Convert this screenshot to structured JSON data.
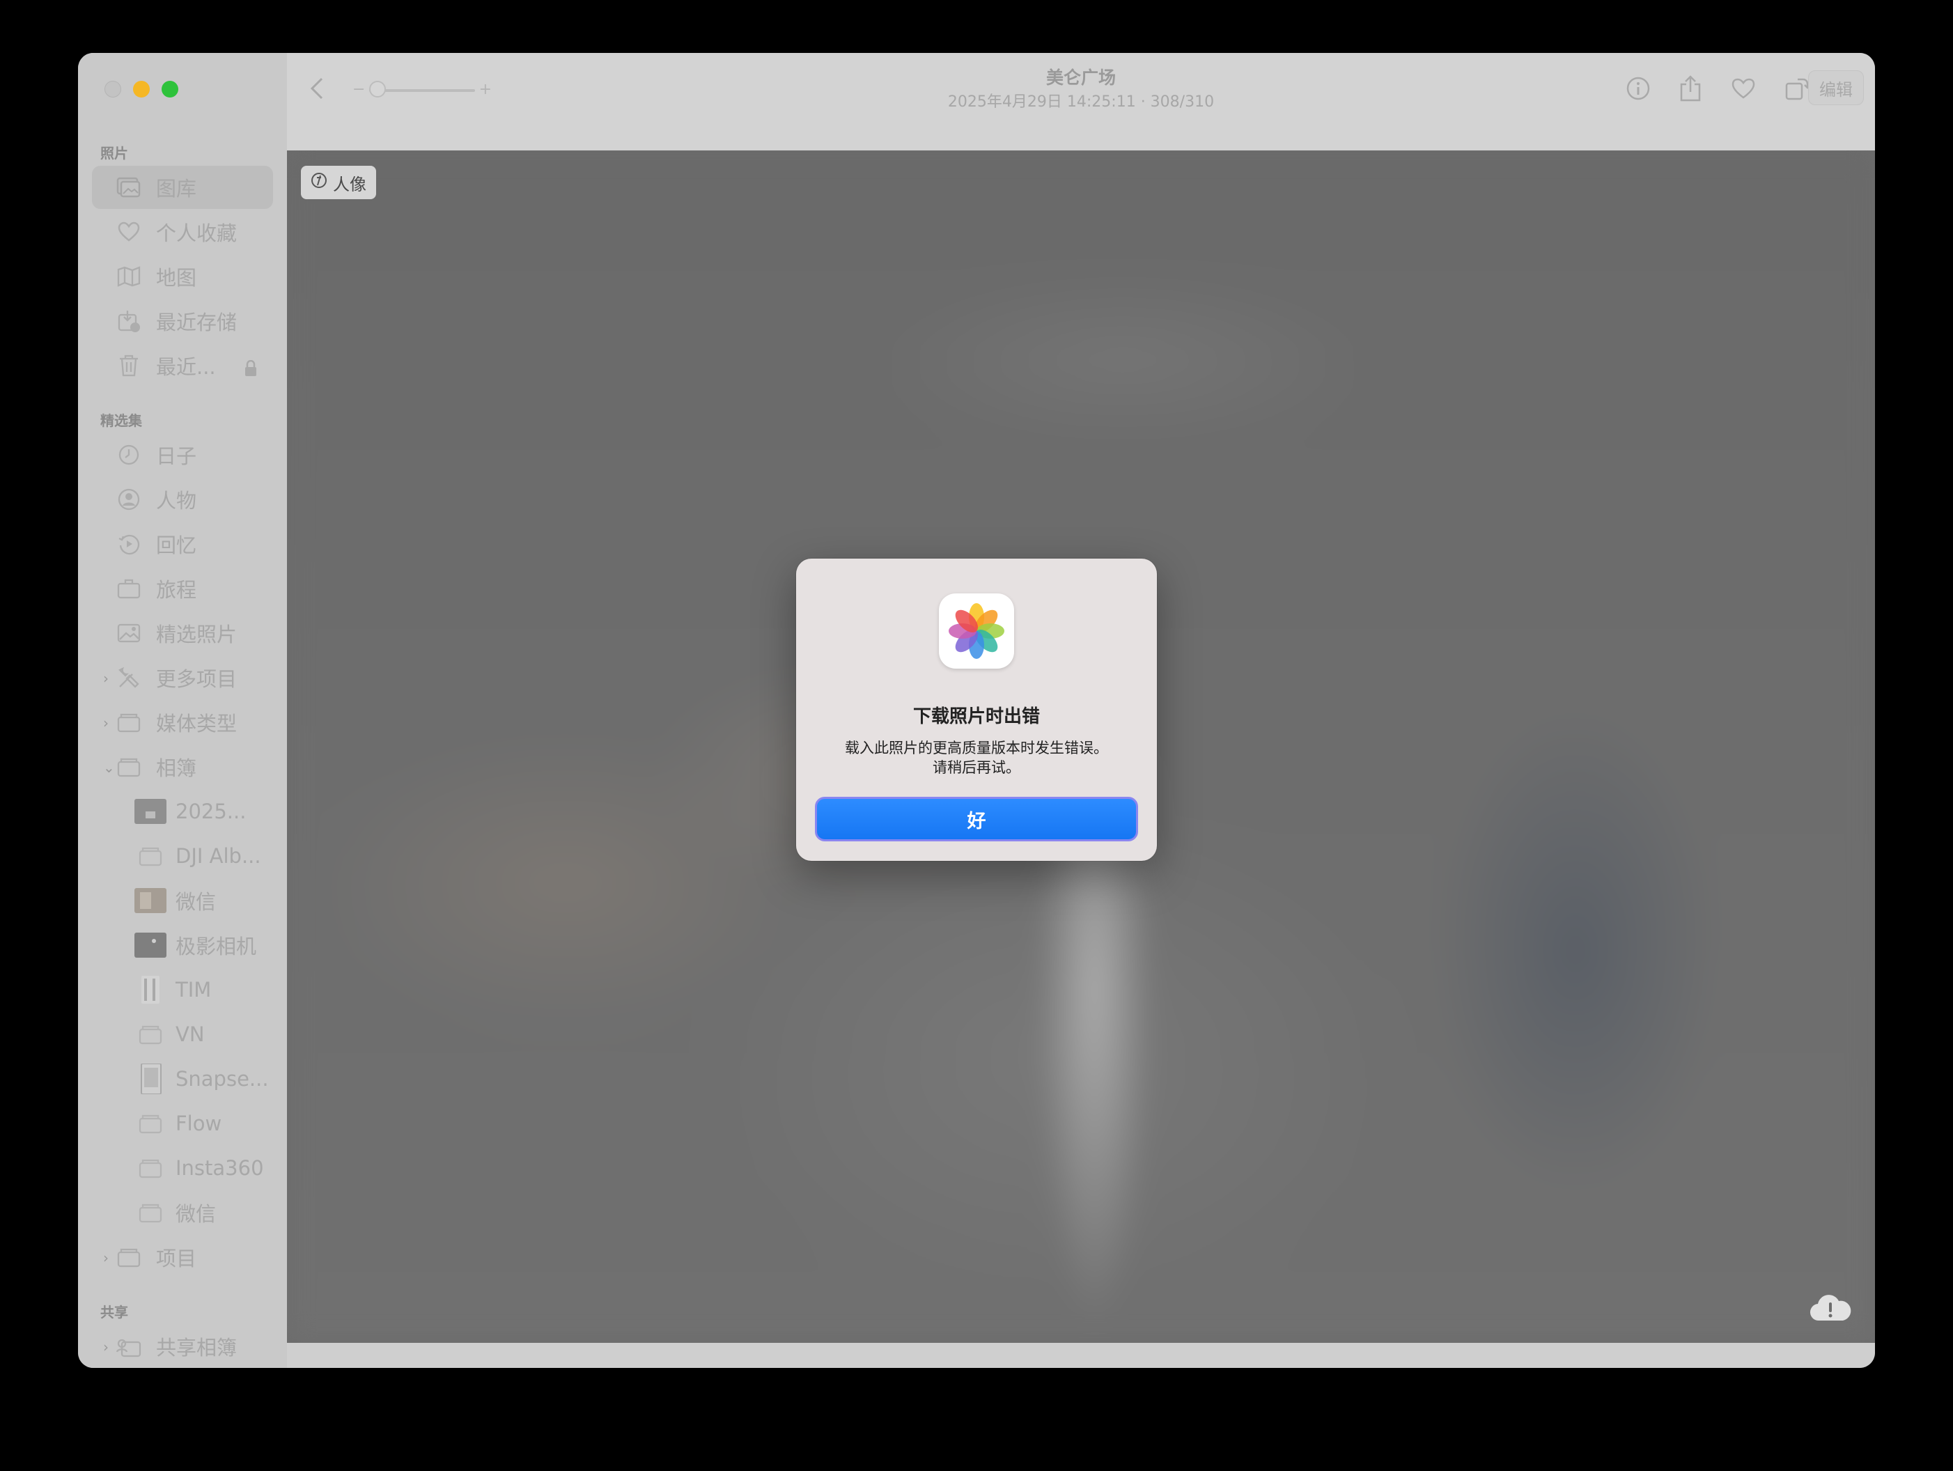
{
  "toolbar": {
    "title": "美仑广场",
    "subtitle": "2025年4月29日 14:25:11 · 308/310",
    "edit_label": "编辑",
    "zoom_minus": "−",
    "zoom_plus": "+"
  },
  "sidebar": {
    "section_photos": "照片",
    "section_featured": "精选集",
    "section_shared": "共享",
    "items": [
      {
        "label": "图库",
        "icon": "library-icon"
      },
      {
        "label": "个人收藏",
        "icon": "heart-icon"
      },
      {
        "label": "地图",
        "icon": "map-icon"
      },
      {
        "label": "最近存储",
        "icon": "recently-saved-icon"
      },
      {
        "label": "最近...",
        "icon": "trash-icon"
      },
      {
        "label": "日子",
        "icon": "clock-icon"
      },
      {
        "label": "人物",
        "icon": "person-icon"
      },
      {
        "label": "回忆",
        "icon": "memories-icon"
      },
      {
        "label": "旅程",
        "icon": "suitcase-icon"
      },
      {
        "label": "精选照片",
        "icon": "photo-icon"
      },
      {
        "label": "更多项目",
        "icon": "tools-icon"
      },
      {
        "label": "媒体类型",
        "icon": "folder-icon"
      },
      {
        "label": "相簿",
        "icon": "folder-icon"
      },
      {
        "label": "2025...",
        "icon": "album-thumb-icon"
      },
      {
        "label": "DJI Alb...",
        "icon": "album-icon"
      },
      {
        "label": "微信",
        "icon": "album-thumb-icon"
      },
      {
        "label": "极影相机",
        "icon": "album-thumb-icon"
      },
      {
        "label": "TIM",
        "icon": "album-thumb-icon"
      },
      {
        "label": "VN",
        "icon": "album-icon"
      },
      {
        "label": "Snapse...",
        "icon": "album-thumb-icon"
      },
      {
        "label": "Flow",
        "icon": "album-icon"
      },
      {
        "label": "Insta360",
        "icon": "album-icon"
      },
      {
        "label": "微信",
        "icon": "album-icon"
      },
      {
        "label": "项目",
        "icon": "folder-icon"
      },
      {
        "label": "共享相簿",
        "icon": "shared-album-icon"
      }
    ]
  },
  "viewer": {
    "badge_label": "人像"
  },
  "dialog": {
    "title": "下载照片时出错",
    "message_line1": "载入此照片的更高质量版本时发生错误。",
    "message_line2": "请稍后再试。",
    "ok_label": "好"
  },
  "colors": {
    "accent_blue": "#1676f3",
    "traffic_min": "#f5b725",
    "traffic_max": "#2ec23b"
  }
}
